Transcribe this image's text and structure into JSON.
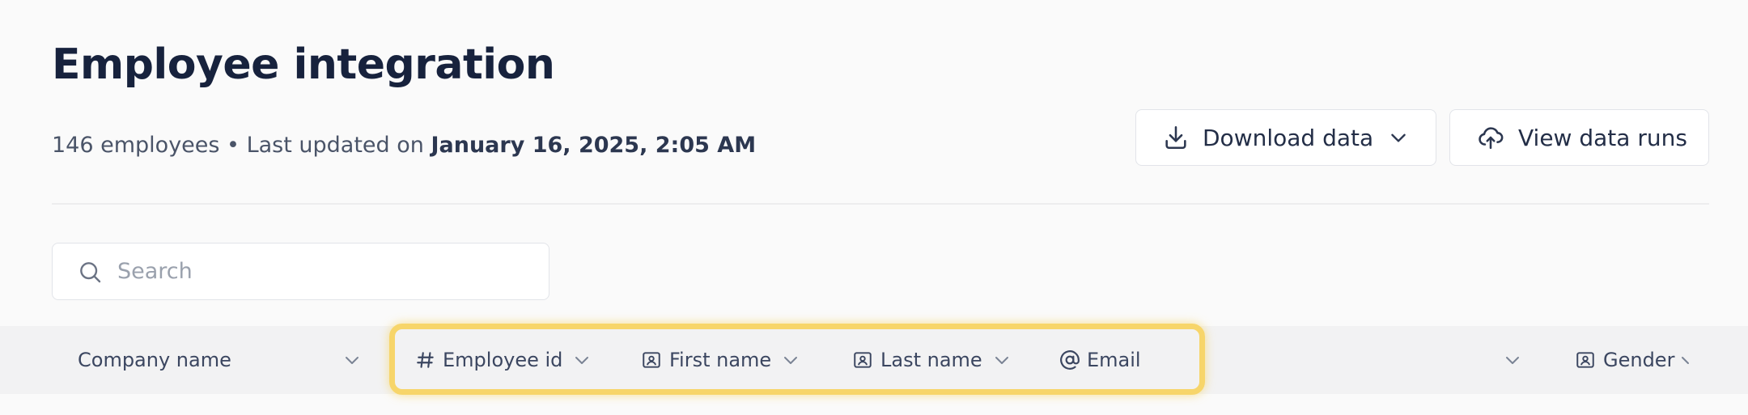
{
  "header": {
    "title": "Employee integration",
    "employee_count": "146 employees",
    "separator": " • ",
    "last_updated_prefix": "Last updated on ",
    "last_updated_date": "January 16, 2025, 2:05 AM"
  },
  "actions": {
    "download_label": "Download data",
    "runs_label": "View data runs"
  },
  "search": {
    "placeholder": "Search"
  },
  "columns": [
    {
      "label": "Company name",
      "icon": "none"
    },
    {
      "label": "Employee id",
      "icon": "hash-icon"
    },
    {
      "label": "First name",
      "icon": "id-card-icon"
    },
    {
      "label": "Last name",
      "icon": "id-card-icon"
    },
    {
      "label": "Email",
      "icon": "at-icon"
    },
    {
      "label": "",
      "icon": "none"
    },
    {
      "label": "Gender",
      "icon": "id-card-icon"
    }
  ],
  "colors": {
    "highlight": "#f7d56a",
    "title": "#17223d",
    "header_row_bg": "#f2f2f3"
  }
}
